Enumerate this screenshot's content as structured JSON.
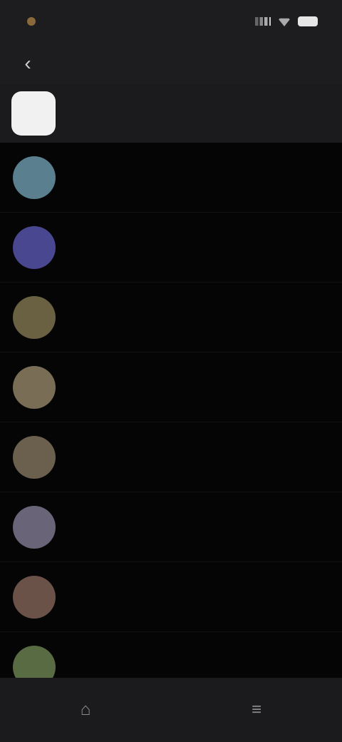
{
  "status_bar": {
    "time": "",
    "signal_icon": "signal-icon",
    "wifi_icon": "wifi-icon",
    "battery_icon": "battery-icon"
  },
  "header": {
    "back_icon": "back-arrow-icon",
    "title": ""
  },
  "tabs": [
    {
      "label": ""
    },
    {
      "label": ""
    }
  ],
  "list": {
    "items": [
      {
        "title": "",
        "subtitle": "",
        "avatar_color": "#5a7f8f"
      },
      {
        "title": "",
        "subtitle": "",
        "avatar_color": "#4a4791"
      },
      {
        "title": "",
        "subtitle": "",
        "avatar_color": "#6a6042"
      },
      {
        "title": "",
        "subtitle": "",
        "avatar_color": "#7a6d55"
      },
      {
        "title": "",
        "subtitle": "",
        "avatar_color": "#6b604e"
      },
      {
        "title": "",
        "subtitle": "",
        "avatar_color": "#696478"
      },
      {
        "title": "",
        "subtitle": "",
        "avatar_color": "#6a5248"
      },
      {
        "title": "",
        "subtitle": "",
        "avatar_color": "#596b42"
      }
    ]
  },
  "bottom_nav": [
    {
      "icon": "home-icon"
    },
    {
      "icon": "menu-icon"
    }
  ],
  "colors": {
    "background": "#050505",
    "bar": "#1d1d1f",
    "text": "#e8e8e8",
    "muted_text": "#8d8d8d"
  }
}
